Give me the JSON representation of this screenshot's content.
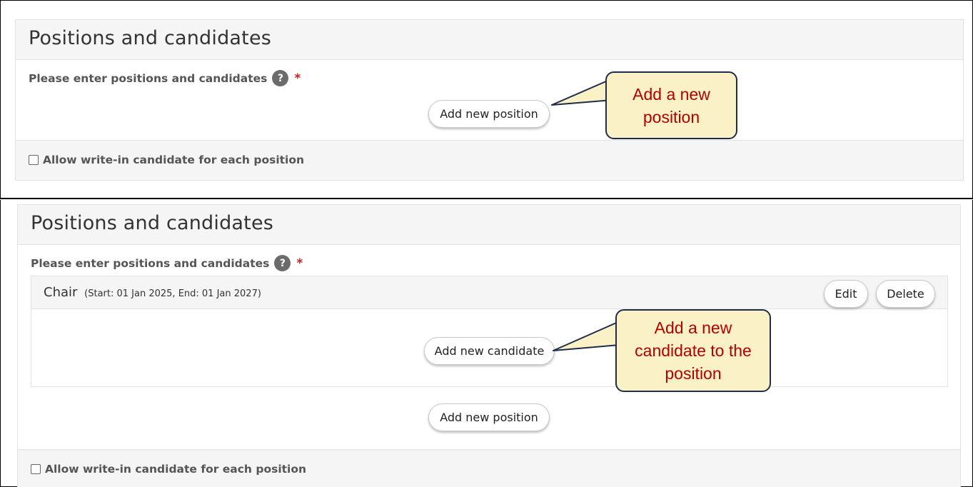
{
  "section_title": "Positions and candidates",
  "field_label": "Please enter positions and candidates",
  "help_glyph": "?",
  "required_glyph": "*",
  "add_position_label": "Add new position",
  "add_candidate_label": "Add new candidate",
  "write_in_label": "Allow write-in candidate for each position",
  "write_in_checked": false,
  "position": {
    "name": "Chair",
    "dates": "(Start: 01 Jan 2025, End: 01 Jan 2027)",
    "edit_label": "Edit",
    "delete_label": "Delete"
  },
  "callouts": {
    "add_position": "Add a new position",
    "add_candidate": "Add a new candidate to the position"
  },
  "colors": {
    "callout_fill": "#fbf1c7",
    "callout_text": "#b30000",
    "callout_border": "#1f2d4a",
    "required": "#cc1f1f",
    "header_bg": "#f5f5f5"
  },
  "icons": {
    "help": "question-circle-icon",
    "checkbox": "checkbox-unchecked-icon"
  }
}
